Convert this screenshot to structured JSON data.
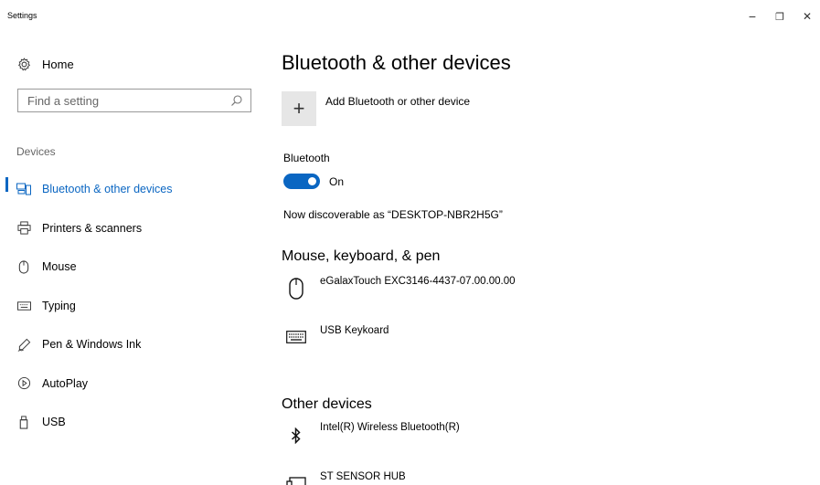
{
  "window": {
    "title": "Settings",
    "controls": {
      "minimize": "−",
      "maximize": "❐",
      "close": "✕"
    }
  },
  "sidebar": {
    "home_label": "Home",
    "search_placeholder": "Find a setting",
    "section": "Devices",
    "items": [
      {
        "label": "Bluetooth & other devices",
        "icon": "bluetooth-devices-icon",
        "active": true
      },
      {
        "label": "Printers & scanners",
        "icon": "printer-icon"
      },
      {
        "label": "Mouse",
        "icon": "mouse-icon"
      },
      {
        "label": "Typing",
        "icon": "keyboard-icon"
      },
      {
        "label": "Pen & Windows Ink",
        "icon": "pen-icon"
      },
      {
        "label": "AutoPlay",
        "icon": "autoplay-icon"
      },
      {
        "label": "USB",
        "icon": "usb-icon"
      }
    ]
  },
  "main": {
    "title": "Bluetooth & other devices",
    "add_device_label": "Add Bluetooth or other device",
    "add_symbol": "+",
    "bluetooth_label": "Bluetooth",
    "toggle_state": "On",
    "discoverable_text": "Now discoverable as “DESKTOP-NBR2H5G”",
    "mouse_section": "Mouse, keyboard, & pen",
    "mouse_devices": [
      {
        "name": "eGalaxTouch EXC3146-4437-07.00.00.00",
        "icon": "mouse-icon"
      },
      {
        "name": "USB Keykoard",
        "icon": "keyboard-icon"
      }
    ],
    "other_section": "Other devices",
    "other_devices": [
      {
        "name": "Intel(R) Wireless Bluetooth(R)",
        "icon": "bluetooth-icon"
      },
      {
        "name": "ST SENSOR HUB",
        "icon": "sensor-hub-icon"
      }
    ]
  },
  "colors": {
    "accent": "#0a66c2",
    "tile": "#e6e6e6"
  }
}
